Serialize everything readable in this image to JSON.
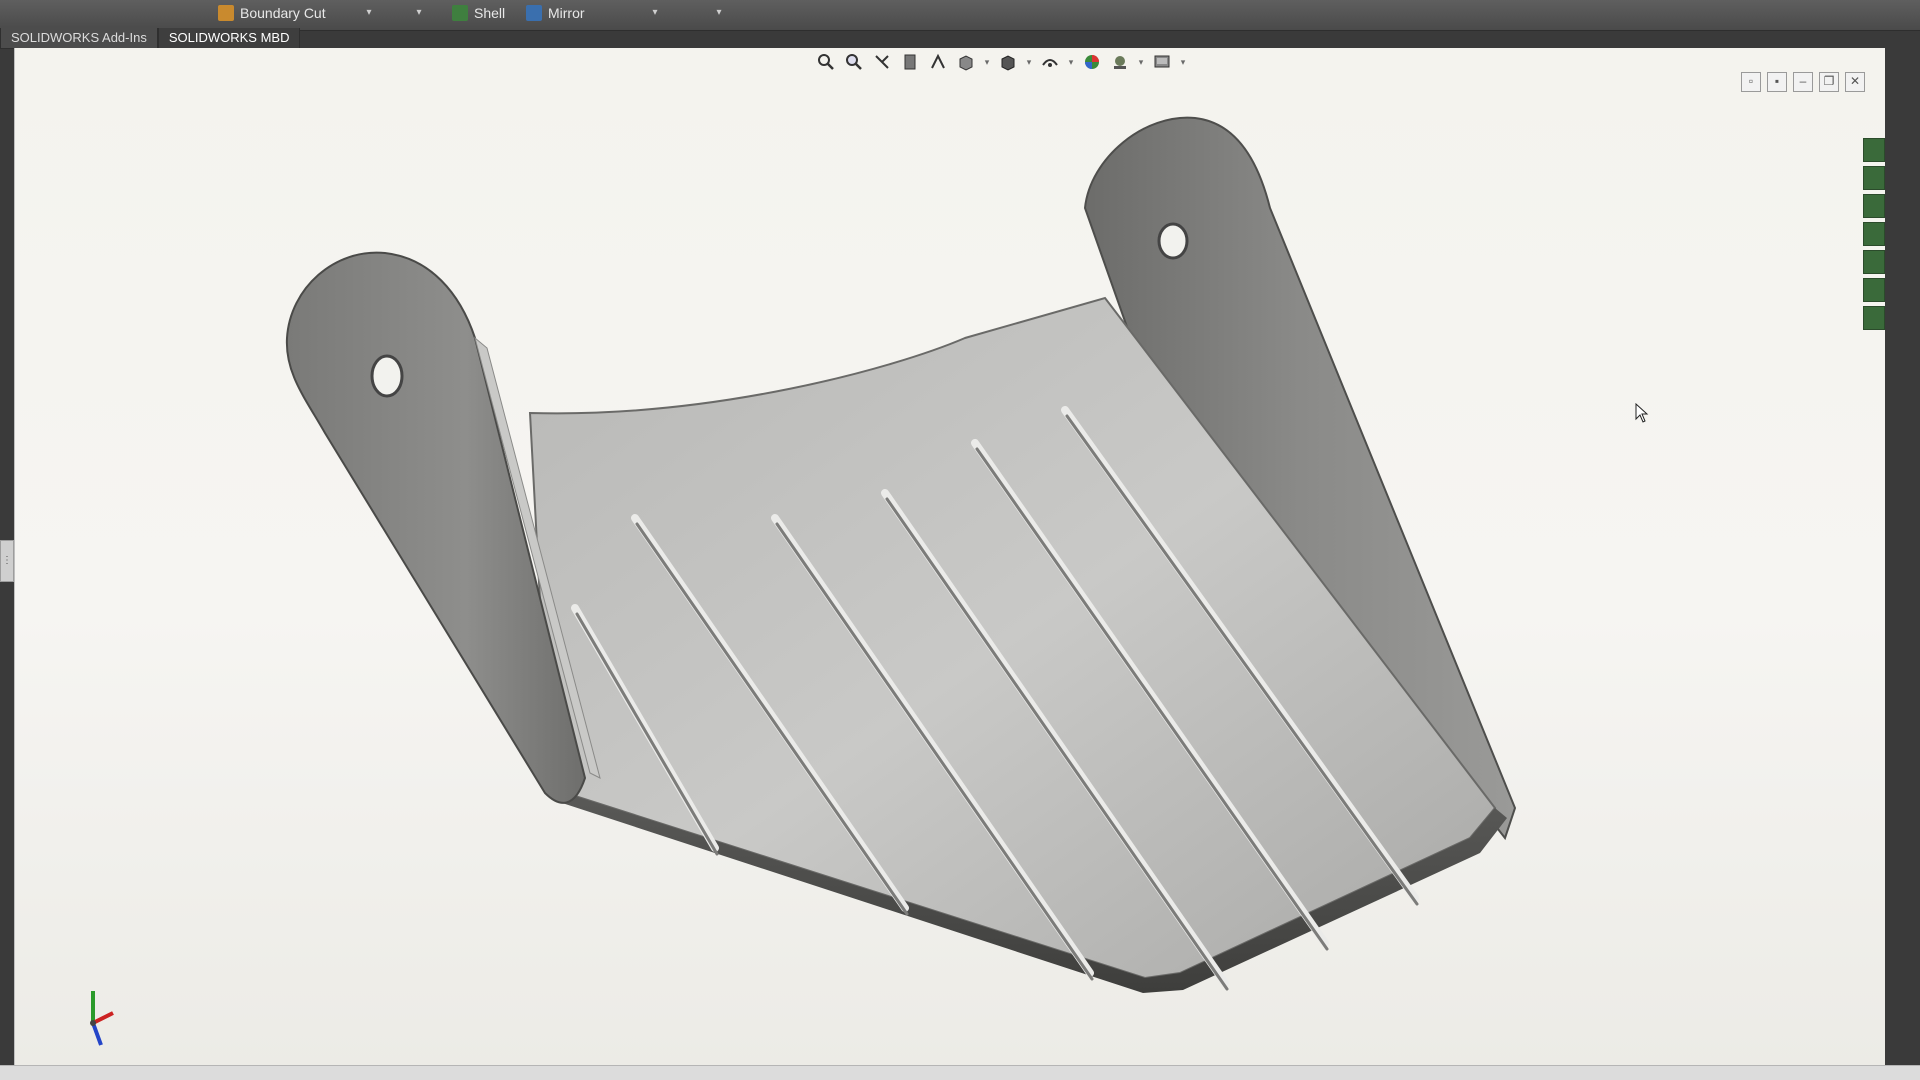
{
  "ribbon": {
    "boundary_cut": "Boundary Cut",
    "shell": "Shell",
    "mirror": "Mirror"
  },
  "tabs": [
    "SOLIDWORKS Add-Ins",
    "SOLIDWORKS MBD"
  ],
  "icons": {
    "zoom_to_fit": "zoom-to-fit-icon",
    "zoom_area": "zoom-area-icon",
    "previous_view": "previous-view-icon",
    "section_view": "section-view-icon",
    "dynamic_annotation": "dynamic-annotation-icon",
    "view_orientation": "view-orientation-icon",
    "display_style": "display-style-icon",
    "hide_show": "hide-show-icon",
    "appearance": "appearance-icon",
    "scene": "scene-icon",
    "view_settings": "view-settings-icon"
  },
  "colors": {
    "part_light": "#c8c8c6",
    "part_mid": "#9a9a98",
    "part_dark": "#5a5a58",
    "background": "#f4f3ee"
  }
}
